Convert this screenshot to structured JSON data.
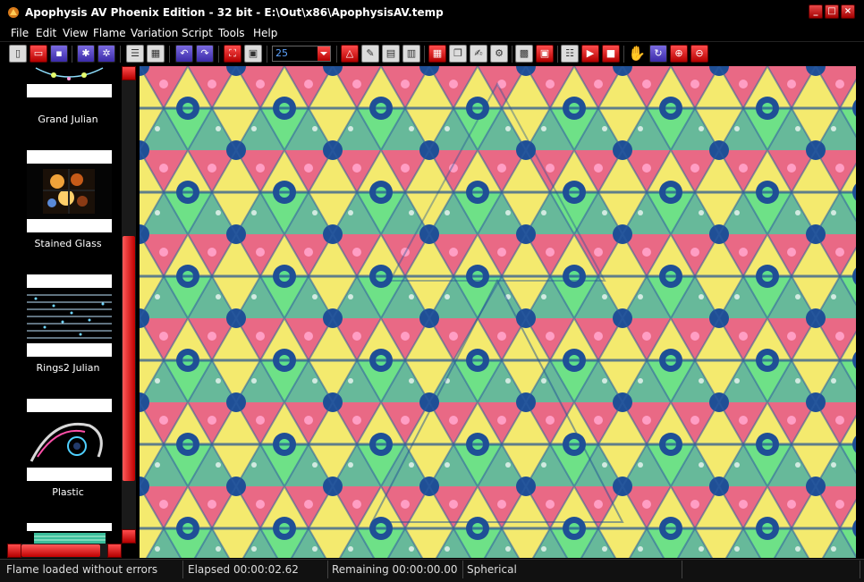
{
  "window": {
    "title": "Apophysis AV Phoenix Edition  - 32 bit - E:\\Out\\x86\\ApophysisAV.temp",
    "controls": {
      "minimize": "_",
      "maximize": "□",
      "close": "×"
    }
  },
  "menu": [
    "File",
    "Edit",
    "View",
    "Flame",
    "Variation",
    "Script",
    "Tools",
    "Help"
  ],
  "toolbar": {
    "zoom_value": "25",
    "buttons": [
      "new",
      "open",
      "save",
      "randomize",
      "mutate",
      "list-view",
      "icon-view",
      "undo",
      "redo",
      "full-screen",
      "edit",
      "zoom-combo",
      "editor",
      "adjust",
      "color-gradient",
      "mutation",
      "transform",
      "script-editor",
      "options",
      "toggle-transparency",
      "render",
      "messages",
      "run-script",
      "stop-script",
      "pan-hand",
      "rotate",
      "zoom-in",
      "zoom-out"
    ]
  },
  "thumbnails": [
    {
      "label": "Grand Julian"
    },
    {
      "label": "Stained Glass"
    },
    {
      "label": "Rings2 Julian"
    },
    {
      "label": "Plastic"
    }
  ],
  "status": {
    "message": "Flame loaded without errors",
    "elapsed": "Elapsed 00:00:02.62",
    "remaining": "Remaining 00:00:00.00",
    "variation": "Spherical"
  },
  "colors": {
    "accent_red": "#d40000",
    "canvas_yellow": "#f4ea6e",
    "canvas_pink": "#e8528a",
    "canvas_green": "#5fe08a",
    "canvas_blue": "#1f4f96",
    "canvas_teal": "#38a8a8"
  }
}
